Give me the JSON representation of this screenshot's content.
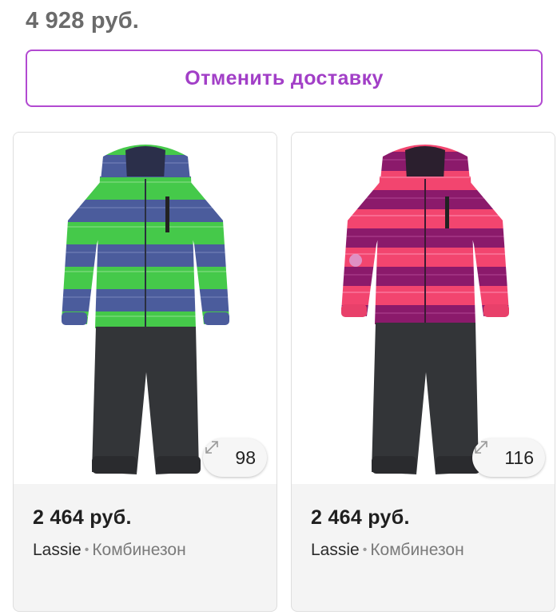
{
  "order": {
    "total_price": "4 928 руб.",
    "cancel_button_label": "Отменить доставку"
  },
  "products": [
    {
      "price": "2 464 руб.",
      "brand": "Lassie",
      "separator": "•",
      "category": "Комбинезон",
      "size": "98",
      "size_icon": "expand-arrows-icon",
      "image": "green-blue-striped-snowsuit",
      "colors": {
        "stripe_a": "#45c94a",
        "stripe_b": "#4b5c9c",
        "pants": "#333538"
      }
    },
    {
      "price": "2 464 руб.",
      "brand": "Lassie",
      "separator": "•",
      "category": "Комбинезон",
      "size": "116",
      "size_icon": "expand-arrows-icon",
      "image": "pink-purple-striped-snowsuit",
      "colors": {
        "stripe_a": "#f2456f",
        "stripe_b": "#8b1a6b",
        "pants": "#333538"
      }
    }
  ]
}
